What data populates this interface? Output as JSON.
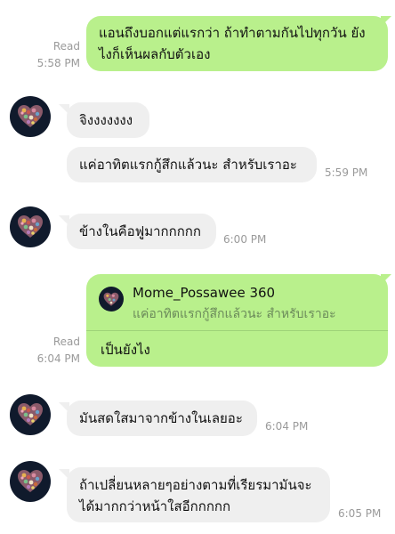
{
  "messages": [
    {
      "text": "แอนถึงบอกแต่แรกว่า ถ้าทำตามกันไปทุกวัน ยังไงก็เห็นผลกับตัวเอง",
      "read": "Read",
      "time": "5:58 PM"
    },
    {
      "text": "จิงงงงงงง"
    },
    {
      "text": "แค่อาทิตแรกกู้สึกแล้วนะ สำหรับเราอะ",
      "time": "5:59 PM"
    },
    {
      "text": "ข้างในคือฟูมากกกกก",
      "time": "6:00 PM"
    },
    {
      "reply_name": "Mome_Possawee 360",
      "reply_quote": "แค่อาทิตแรกกู้สึกแล้วนะ สำหรับเราอะ",
      "text": "เป็นยังไง",
      "read": "Read",
      "time": "6:04 PM"
    },
    {
      "text": "มันสดใสมาจากข้างในเลยอะ",
      "time": "6:04 PM"
    },
    {
      "text": "ถ้าเปลี่ยนหลายๆอย่างตามที่เรียรมามันจะ ได้มากกว่าหน้าใสอีกกกกก",
      "time": "6:05 PM"
    }
  ],
  "colors": {
    "outgoing_bubble": "#b9f08c",
    "incoming_bubble": "#efefef",
    "avatar_bg": "#101a2c"
  },
  "icons": {
    "avatar": "heart-photo-collage-avatar"
  }
}
